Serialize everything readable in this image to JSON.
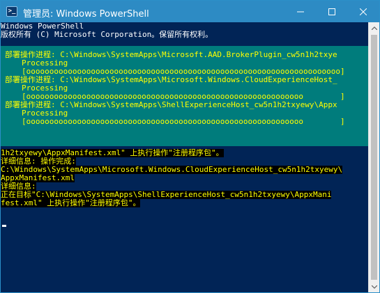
{
  "window": {
    "title": "管理员: Windows PowerShell",
    "icon": "powershell-icon",
    "controls": [
      "minimize-icon",
      "maximize-icon",
      "close-icon"
    ]
  },
  "console": {
    "header": [
      "Windows PowerShell",
      "版权所有 (C) Microsoft Corporation。保留所有权利。"
    ],
    "progress": [
      {
        "activity": "部署操作进程: C:\\Windows\\SystemApps\\Microsoft.AAD.BrokerPlugin_cw5n1h2txye",
        "status": "Processing",
        "bar": "[oooooooooooooooooooooooooooooooooooooooooooooooooooooooooooooooooooo]"
      },
      {
        "activity": "部署操作进程: C:\\Windows\\SystemApps\\Microsoft.Windows.CloudExperienceHost_",
        "status": "Processing",
        "bar": "[oooooooooooooooooooooooooooooooooooooooooooooooooooooooooooo        ]"
      },
      {
        "activity": "部署操作进程: C:\\Windows\\SystemApps\\ShellExperienceHost_cw5n1h2txyewy\\Appx",
        "status": "Processing",
        "bar": "[oooooooooooooooooooooooooooooooooooooooooooooooooooooooooooo        ]"
      }
    ],
    "output": [
      "1h2txyewy\\AppxManifest.xml\" 上执行操作\"注册程序包\"。",
      "详细信息: 操作完成:",
      "C:\\Windows\\SystemApps\\Microsoft.Windows.CloudExperienceHost_cw5n1h2txyewy\\",
      "AppxManifest.xml",
      "详细信息:",
      "正在目标\"C:\\Windows\\SystemApps\\ShellExperienceHost_cw5n1h2txyewy\\AppxMani",
      "fest.xml\" 上执行操作\"注册程序包\"。"
    ]
  },
  "colors": {
    "titlebar": "#2d8bc4",
    "console_bg": "#012456",
    "progress_bg": "#007c7c",
    "progress_text": "#ffff00",
    "verbose_text": "#ffff00"
  }
}
